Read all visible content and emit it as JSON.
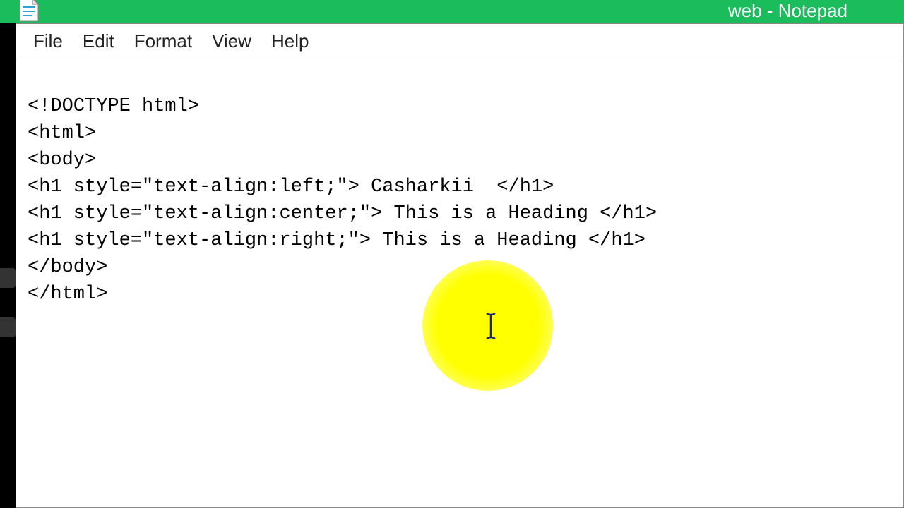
{
  "window": {
    "title": "web - Notepad"
  },
  "menu": {
    "file": "File",
    "edit": "Edit",
    "format": "Format",
    "view": "View",
    "help": "Help"
  },
  "lines": {
    "l0": "<!DOCTYPE html>",
    "l1": "<html>",
    "l2": "<body>",
    "l3": "<h1 style=\"text-align:left;\"> Casharkii  </h1>",
    "l4": "<h1 style=\"text-align:center;\"> This is a Heading </h1>",
    "l5": "<h1 style=\"text-align:right;\"> This is a Heading </h1>",
    "l6": "</body>",
    "l7": "</html>"
  }
}
